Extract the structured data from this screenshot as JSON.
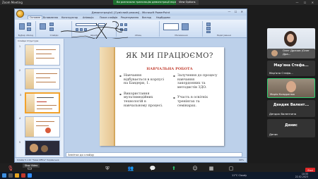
{
  "zoom": {
    "app_title": "Zoom Meeting",
    "share_banner": "Ви розпочали трансляцію демонстрації екрану",
    "view_options": "View Options",
    "window_controls": "— ☐ ✕"
  },
  "powerpoint": {
    "title": "Демонстрація1 [Сумісний режим] - Microsoft PowerPoint",
    "ribbon_tabs": [
      "Основне",
      "Вставлення",
      "Конструктор",
      "Анімація",
      "Показ слайдів",
      "Рецензування",
      "Вигляд",
      "Надбудови"
    ],
    "ribbon_groups": [
      "Буфер обміну",
      "Слайди",
      "Шрифт",
      "Абзац",
      "Малювання",
      "Редагування"
    ],
    "pane_tabs": "Слайди   Структура",
    "thumbnails": [
      "1",
      "2",
      "3",
      "4",
      "5"
    ],
    "notes_placeholder": "Замітки до слайду",
    "status_left": "Слайд 5 з 22   \"Тема Office\"   Українська",
    "status_zoom": "66%",
    "slide": {
      "title": "ЯК  МИ  ПРАЦЮЄМО?",
      "subtitle": "НАВЧАЛЬНА  РОБОТА",
      "left_bullets": [
        "Навчання відбувається в корпусі на Бандери, 1.",
        "Використання мультимедійних технологій в навчальному процесі."
      ],
      "right_bullets": [
        "Залучення до процесу навчання закордонних та методистів ЗДО.",
        "Участь в освітніх тренінгах та семінарах."
      ]
    }
  },
  "participants": [
    {
      "label": "Олег Драчов (Олег Дра...",
      "type": "video"
    },
    {
      "label": "Мар'яна Стефа...",
      "big": "Мар'яна Стефа...",
      "type": "video"
    },
    {
      "label": "Марія Кондратюк",
      "type": "video",
      "active": true
    },
    {
      "label": "Дендик Валентина",
      "big": "Дендик Валент...",
      "type": "name"
    },
    {
      "label": "Денис",
      "big": "Денис",
      "type": "name"
    }
  ],
  "toolbar": {
    "unmute": "Unmute",
    "stop_video": "Stop Video",
    "video_menu": "Stop Video",
    "security": "Security",
    "participants": "Participants",
    "participants_count": "14",
    "chat": "Chat",
    "share_screen": "Share Screen",
    "reactions": "Reactions",
    "apps": "Apps",
    "whiteboards": "Whiteboards",
    "end": "End"
  },
  "taskbar": {
    "weather": "11°C  Cloudy",
    "time": "10:33",
    "date": "22.02.2023"
  }
}
